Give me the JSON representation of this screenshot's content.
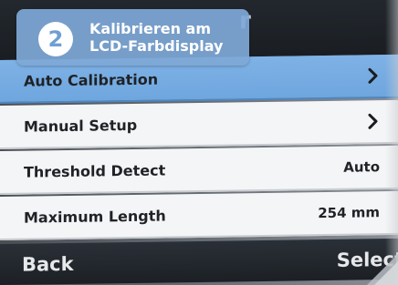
{
  "badge": {
    "step_number": "2",
    "line1": "Kalibrieren am",
    "line2": "LCD-Farbdisplay",
    "color": "#7ea8d6"
  },
  "title_bar": {
    "visible_fragment": "r"
  },
  "menu": {
    "items": [
      {
        "label": "Auto Calibration",
        "value": "",
        "has_chevron": true,
        "selected": true
      },
      {
        "label": "Manual Setup",
        "value": "",
        "has_chevron": true,
        "selected": false
      },
      {
        "label": "Threshold Detect",
        "value": "Auto",
        "has_chevron": false,
        "selected": false
      },
      {
        "label": "Maximum Length",
        "value": "254 mm",
        "has_chevron": false,
        "selected": false
      }
    ],
    "chevron_icon": "chevron-right-icon",
    "selected_color": "#74aae0"
  },
  "softkeys": {
    "left": "Back",
    "right": "Select"
  }
}
